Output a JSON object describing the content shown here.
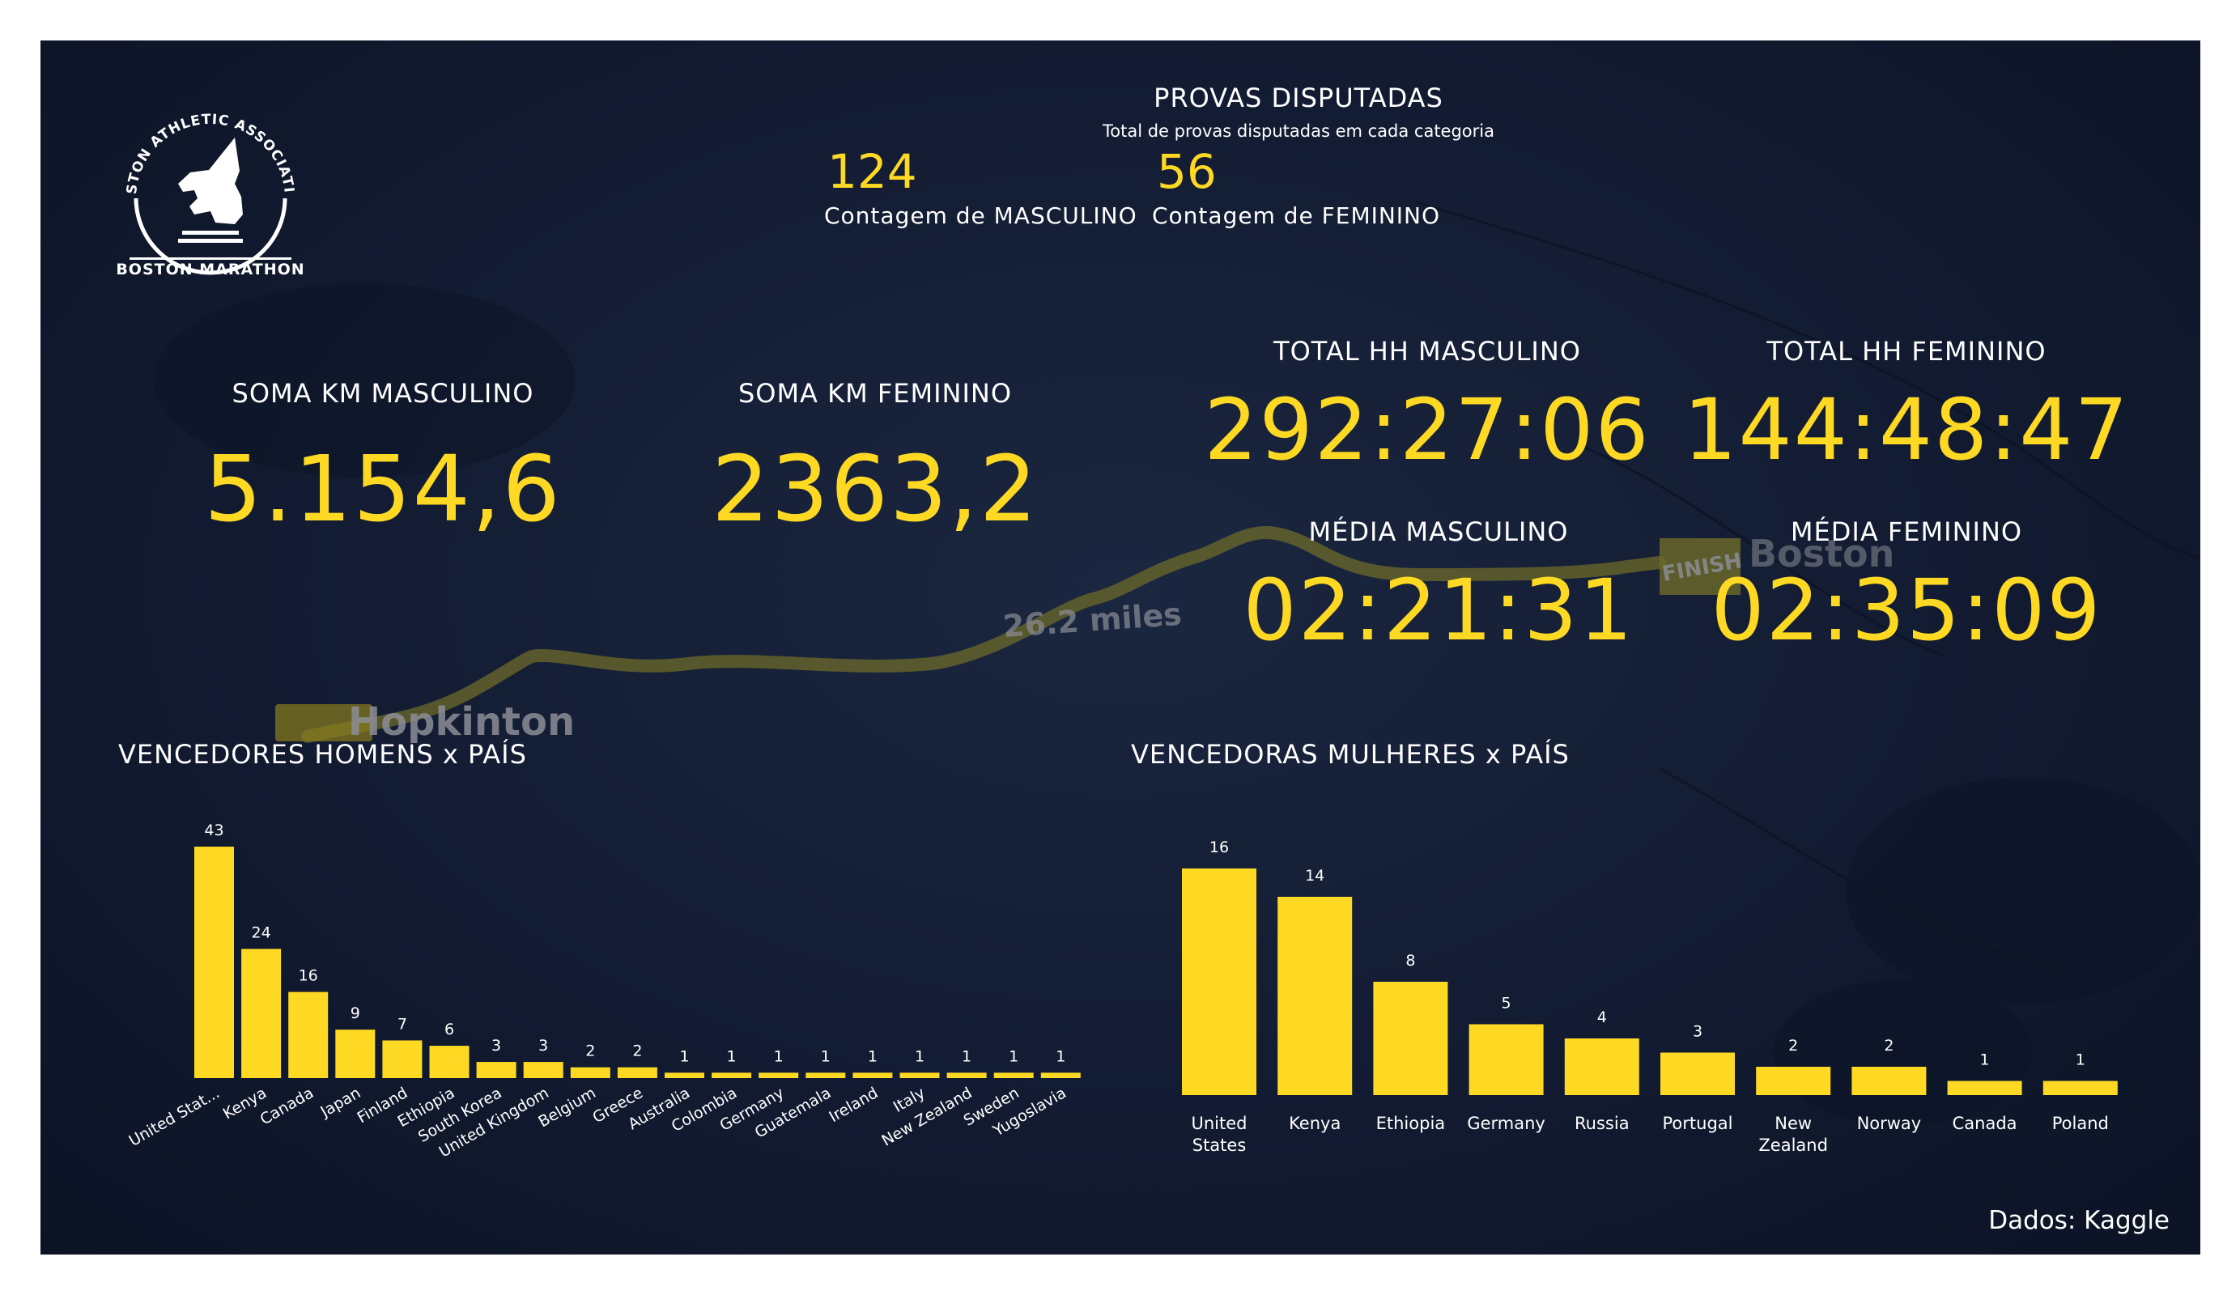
{
  "logo": {
    "org": "BOSTON ATHLETIC ASSOCIATION",
    "event": "BOSTON MARATHON"
  },
  "header": {
    "title": "PROVAS DISPUTADAS",
    "subtitle": "Total de provas disputadas em cada categoria",
    "masc_count": "124",
    "masc_label": "Contagem de MASCULINO",
    "fem_count": "56",
    "fem_label": "Contagem de FEMININO"
  },
  "map": {
    "start": "Hopkinton",
    "distance": "26.2 miles",
    "finish": "FINISH",
    "city": "Boston"
  },
  "kpis": {
    "soma_km_masc_label": "SOMA KM MASCULINO",
    "soma_km_masc": "5.154,6",
    "soma_km_fem_label": "SOMA KM FEMININO",
    "soma_km_fem": "2363,2",
    "total_hh_masc_label": "TOTAL HH MASCULINO",
    "total_hh_masc": "292:27:06",
    "total_hh_fem_label": "TOTAL HH FEMININO",
    "total_hh_fem": "144:48:47",
    "media_masc_label": "MÉDIA MASCULINO",
    "media_masc": "02:21:31",
    "media_fem_label": "MÉDIA FEMININO",
    "media_fem": "02:35:09"
  },
  "colors": {
    "accent": "#fed923",
    "background": "#121b31",
    "text": "#ffffff"
  },
  "chart_data": [
    {
      "type": "bar",
      "title": "VENCEDORES HOMENS x PAÍS",
      "categories": [
        "United Stat...",
        "Kenya",
        "Canada",
        "Japan",
        "Finland",
        "Ethiopia",
        "South Korea",
        "United Kingdom",
        "Belgium",
        "Greece",
        "Australia",
        "Colombia",
        "Germany",
        "Guatemala",
        "Ireland",
        "Italy",
        "New Zealand",
        "Sweden",
        "Yugoslavia"
      ],
      "values": [
        43,
        24,
        16,
        9,
        7,
        6,
        3,
        3,
        2,
        2,
        1,
        1,
        1,
        1,
        1,
        1,
        1,
        1,
        1
      ],
      "data_labels": true,
      "grid": false
    },
    {
      "type": "bar",
      "title": "VENCEDORAS MULHERES x PAÍS",
      "categories": [
        [
          "United",
          "States"
        ],
        [
          "Kenya"
        ],
        [
          "Ethiopia"
        ],
        [
          "Germany"
        ],
        [
          "Russia"
        ],
        [
          "Portugal"
        ],
        [
          "New",
          "Zealand"
        ],
        [
          "Norway"
        ],
        [
          "Canada"
        ],
        [
          "Poland"
        ]
      ],
      "values": [
        16,
        14,
        8,
        5,
        4,
        3,
        2,
        2,
        1,
        1
      ],
      "data_labels": true,
      "grid": false
    }
  ],
  "footer": {
    "source": "Dados: Kaggle"
  }
}
